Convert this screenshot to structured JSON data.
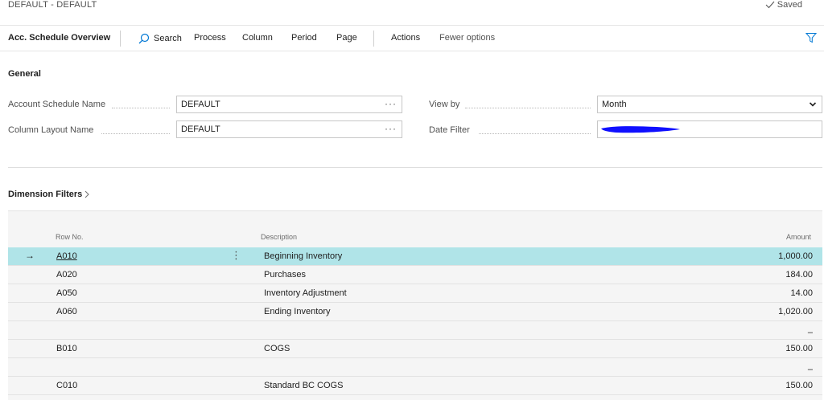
{
  "page": {
    "breadcrumb": "DEFAULT - DEFAULT",
    "saved": "Saved"
  },
  "actionbar": {
    "title": "Acc. Schedule Overview",
    "search": "Search",
    "process": "Process",
    "column": "Column",
    "period": "Period",
    "page": "Page",
    "actions": "Actions",
    "fewer": "Fewer options"
  },
  "general": {
    "title": "General",
    "account_schedule_name": {
      "label": "Account Schedule Name",
      "value": "DEFAULT"
    },
    "column_layout_name": {
      "label": "Column Layout Name",
      "value": "DEFAULT"
    },
    "view_by": {
      "label": "View by",
      "value": "Month"
    },
    "date_filter": {
      "label": "Date Filter",
      "value": ""
    }
  },
  "dimension_filters": {
    "label": "Dimension Filters"
  },
  "grid": {
    "headers": {
      "row_no": "Row No.",
      "description": "Description",
      "amount": "Amount"
    },
    "rows": [
      {
        "row_no": "A010",
        "description": "Beginning Inventory",
        "amount": "1,000.00",
        "selected": true
      },
      {
        "row_no": "A020",
        "description": "Purchases",
        "amount": "184.00"
      },
      {
        "row_no": "A050",
        "description": "Inventory Adjustment",
        "amount": "14.00"
      },
      {
        "row_no": "A060",
        "description": "Ending Inventory",
        "amount": "1,020.00"
      },
      {
        "row_no": "",
        "description": "",
        "amount": "–"
      },
      {
        "row_no": "B010",
        "description": "COGS",
        "amount": "150.00"
      },
      {
        "row_no": "",
        "description": "",
        "amount": "–"
      },
      {
        "row_no": "C010",
        "description": "Standard BC COGS",
        "amount": "150.00"
      }
    ]
  },
  "colors": {
    "accent": "#0078d4",
    "selected_row": "#b0e4e8",
    "redaction": "#1010ff"
  },
  "icons": [
    "check-icon",
    "search-icon",
    "filter-icon",
    "ellipsis-icon",
    "chevron-down-icon",
    "chevron-right-icon",
    "row-arrow-icon",
    "kebab-icon"
  ]
}
